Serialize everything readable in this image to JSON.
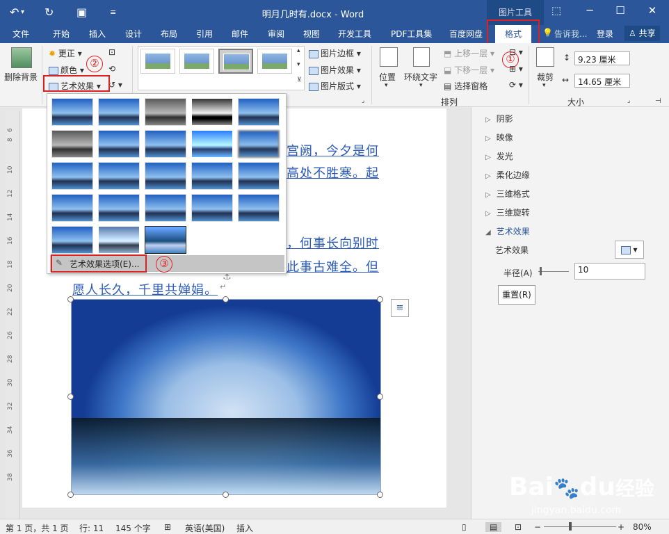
{
  "titlebar": {
    "undo_icon": "undo-icon",
    "redo_icon": "redo-icon",
    "save_icon": "save-icon",
    "customize_icon": "customize-icon",
    "title": "明月几时有.docx - Word",
    "picture_tools": "图片工具",
    "restore_icon": "ribbon-display-icon",
    "minimize": "─",
    "maximize": "☐",
    "close": "✕"
  },
  "tabs": [
    "文件",
    "开始",
    "插入",
    "设计",
    "布局",
    "引用",
    "邮件",
    "审阅",
    "视图",
    "开发工具",
    "PDF工具集",
    "百度网盘"
  ],
  "active_tab": "格式",
  "tell_me": "告诉我...",
  "login": "登录",
  "share": "共享",
  "ribbon": {
    "remove_bg": "删除背景",
    "corrections": "更正",
    "color": "颜色",
    "artistic_effects": "艺术效果",
    "picture_border": "图片边框",
    "picture_effects": "图片效果",
    "picture_layout": "图片版式",
    "position": "位置",
    "wrap_text": "环绕文字",
    "bring_forward": "上移一层",
    "send_backward": "下移一层",
    "selection_pane": "选择窗格",
    "arrange_label": "排列",
    "crop": "裁剪",
    "height": "9.23 厘米",
    "width": "14.65 厘米",
    "size_label": "大小"
  },
  "gallery": {
    "footer_label": "艺术效果选项(E)..."
  },
  "document": {
    "lines": [
      "宫阙，今夕是何",
      "高处不胜寒。起",
      "，何事长向别时",
      "此事古难全。但",
      "愿人长久，千里共婵娟。"
    ]
  },
  "ruler_numbers": [
    "6",
    "8",
    "10",
    "12",
    "14",
    "16",
    "18",
    "20",
    "22",
    "26",
    "28",
    "30",
    "32",
    "34",
    "36",
    "38"
  ],
  "pane": {
    "items": [
      "阴影",
      "映像",
      "发光",
      "柔化边缘",
      "三维格式",
      "三维旋转"
    ],
    "expanded": "艺术效果",
    "effect_label": "艺术效果",
    "radius_label": "半径(A)",
    "radius_value": "10",
    "reset": "重置(R)"
  },
  "annotations": [
    "①",
    "②",
    "③"
  ],
  "statusbar": {
    "page": "第 1 页，共 1 页",
    "line": "行: 11",
    "chars": "145 个字",
    "language": "英语(美国)",
    "mode": "插入",
    "zoom": "80%"
  },
  "watermark": {
    "brand": "Bai",
    "brand2": "du",
    "suffix": "经验",
    "url": "jingyan.baidu.com"
  },
  "colors": {
    "accent": "#2b579a",
    "highlight": "#e02020",
    "link_text": "#2c5ab8"
  }
}
